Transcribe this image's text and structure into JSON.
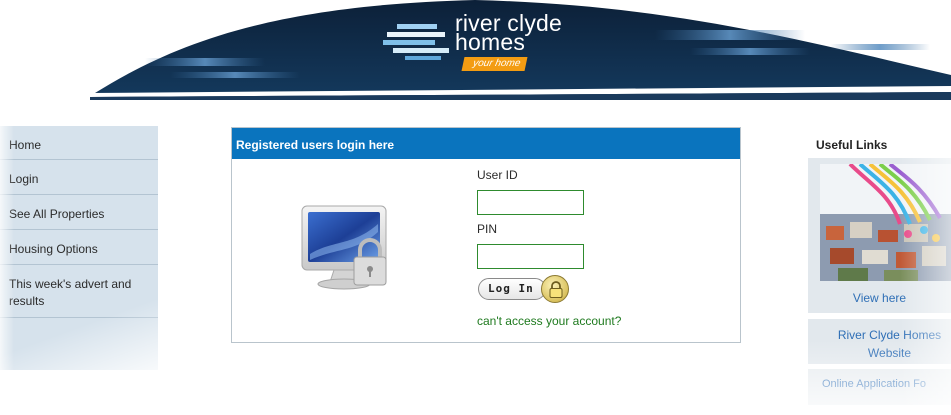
{
  "header": {
    "logo": {
      "name_line1": "river clyde",
      "name_line2": "homes",
      "tagline": "your home"
    },
    "colors": {
      "navy": "#0f2742",
      "accent_orange": "#f39c12"
    }
  },
  "left_nav": {
    "items": [
      {
        "label": "Home"
      },
      {
        "label": "Login"
      },
      {
        "label": "See All Properties"
      },
      {
        "label": "Housing Options"
      },
      {
        "label": "This week's advert and results"
      }
    ]
  },
  "login": {
    "header": "Registered users login here",
    "user_id_label": "User ID",
    "user_id_value": "",
    "pin_label": "PIN",
    "pin_value": "",
    "login_button": "Log In",
    "cant_access_link": "can't access your account?",
    "icons": {
      "computer": "computer-lock-icon",
      "button": "padlock-icon"
    },
    "colors": {
      "header_bg": "#0a74be",
      "field_border": "#2e8b2e",
      "link": "#1f7a1f"
    }
  },
  "useful_links": {
    "title": "Useful Links",
    "promo": {
      "link": "View here",
      "image": "town-rooftops-ribbon-image"
    },
    "river_clyde_link": "River Clyde Homes Website",
    "online_application_link": "Online Application Fo",
    "colors": {
      "link": "#2f6fb6",
      "box_bg": "#e2e8ed"
    }
  }
}
